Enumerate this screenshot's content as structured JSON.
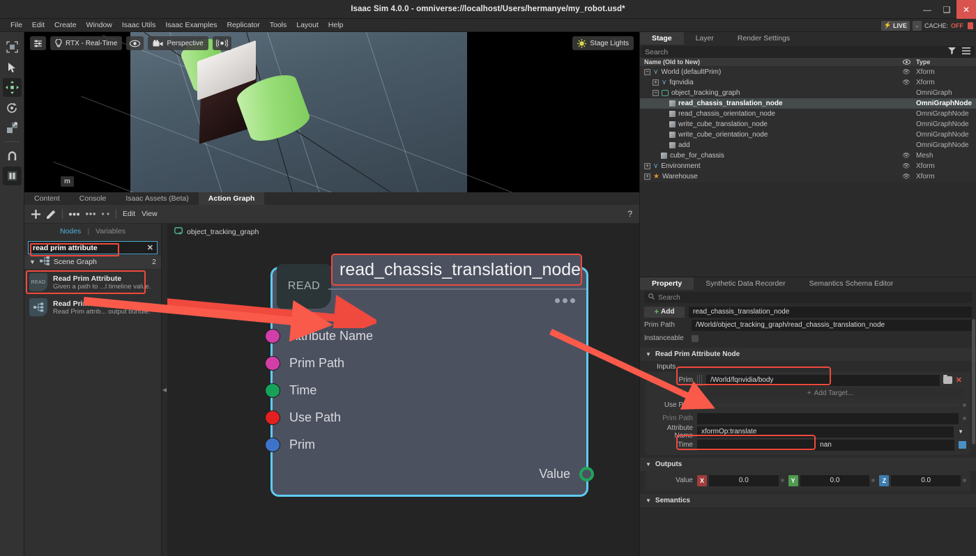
{
  "window": {
    "title": "Isaac Sim 4.0.0 - omniverse://localhost/Users/hermanye/my_robot.usd*",
    "minimize": "—",
    "maximize": "❑",
    "close": "✕"
  },
  "menubar": {
    "items": [
      "File",
      "Edit",
      "Create",
      "Window",
      "Isaac Utils",
      "Isaac Examples",
      "Replicator",
      "Tools",
      "Layout",
      "Help"
    ],
    "live_label": "LIVE",
    "live_caret": "⌄",
    "cache_label": "CACHE:",
    "cache_value": "OFF"
  },
  "left_toolbar": {
    "items": [
      {
        "name": "select-bounds-tool",
        "glyph": "⬛"
      },
      {
        "name": "cursor-tool",
        "glyph": "➤"
      },
      {
        "name": "move-tool",
        "glyph": "✣"
      },
      {
        "name": "rotate-tool",
        "glyph": "⟳"
      },
      {
        "name": "scale-tool",
        "glyph": "⤡"
      },
      {
        "name": "snap-tool",
        "glyph": "∩"
      },
      {
        "name": "pause-tool",
        "glyph": "❙❙"
      }
    ]
  },
  "viewport": {
    "render_mode": "RTX - Real-Time",
    "camera": "Perspective",
    "lighting": "Stage Lights",
    "unit": "m",
    "settings_icon": "sliders-icon",
    "eye_icon": "eye-icon",
    "audio_icon": "audio-icon"
  },
  "dock_tabs": {
    "items": [
      "Content",
      "Console",
      "Isaac Assets (Beta)",
      "Action Graph"
    ],
    "active": "Action Graph"
  },
  "graph_toolbar": {
    "add": "+",
    "edit_pencil": "✎",
    "menu_edit": "Edit",
    "menu_view": "View",
    "help": "?"
  },
  "node_browser": {
    "tabs": [
      "Nodes",
      "Variables"
    ],
    "active_tab": "Nodes",
    "search_value": "read prim attribute",
    "clear_icon": "✕",
    "group": {
      "label": "Scene Graph",
      "count": "2"
    },
    "results": [
      {
        "icon_text": "READ",
        "title": "Read Prim Attribute",
        "desc": "Given a path to ...l timeline value.",
        "highlighted": true
      },
      {
        "icon_text": "",
        "title": "Read Prim Attributes",
        "desc": "Read Prim attrib... output bundle.",
        "highlighted": false
      }
    ]
  },
  "graph_canvas": {
    "breadcrumb": "object_tracking_graph",
    "node": {
      "badge": "READ",
      "title": "read_chassis_translation_node",
      "inputs": [
        {
          "label": "Attribute Name",
          "color": "#d23ea8"
        },
        {
          "label": "Prim Path",
          "color": "#d23ea8"
        },
        {
          "label": "Time",
          "color": "#17a25a"
        },
        {
          "label": "Use Path",
          "color": "#e32020"
        },
        {
          "label": "Prim",
          "color": "#3d74c9"
        }
      ],
      "outputs": [
        {
          "label": "Value",
          "color": "#20a55c"
        }
      ]
    }
  },
  "stage_panel": {
    "tabs": [
      "Stage",
      "Layer",
      "Render Settings"
    ],
    "active_tab": "Stage",
    "search_placeholder": "Search",
    "filter_icon": "filter-icon",
    "menu_icon": "hamburger-icon",
    "columns": {
      "name": "Name (Old to New)",
      "eye": "eye-icon",
      "type": "Type"
    },
    "rows": [
      {
        "name": "World (defaultPrim)",
        "type": "Xform",
        "indent": 0,
        "expander": "−",
        "icon": "axis",
        "eye": true,
        "selected": false
      },
      {
        "name": "fqnvidia",
        "type": "Xform",
        "indent": 1,
        "expander": "+",
        "icon": "axis",
        "eye": true,
        "selected": false
      },
      {
        "name": "object_tracking_graph",
        "type": "OmniGraph",
        "indent": 1,
        "expander": "−",
        "icon": "graph",
        "eye": false,
        "selected": false
      },
      {
        "name": "read_chassis_translation_node",
        "type": "OmniGraphNode",
        "indent": 3,
        "expander": "",
        "icon": "cube",
        "eye": false,
        "selected": true
      },
      {
        "name": "read_chassis_orientation_node",
        "type": "OmniGraphNode",
        "indent": 3,
        "expander": "",
        "icon": "cube",
        "eye": false,
        "selected": false
      },
      {
        "name": "write_cube_translation_node",
        "type": "OmniGraphNode",
        "indent": 3,
        "expander": "",
        "icon": "cube",
        "eye": false,
        "selected": false
      },
      {
        "name": "write_cube_orientation_node",
        "type": "OmniGraphNode",
        "indent": 3,
        "expander": "",
        "icon": "cube",
        "eye": false,
        "selected": false
      },
      {
        "name": "add",
        "type": "OmniGraphNode",
        "indent": 3,
        "expander": "",
        "icon": "cube",
        "eye": false,
        "selected": false
      },
      {
        "name": "cube_for_chassis",
        "type": "Mesh",
        "indent": 2,
        "expander": "",
        "icon": "cube",
        "eye": true,
        "selected": false
      },
      {
        "name": "Environment",
        "type": "Xform",
        "indent": 0,
        "expander": "+",
        "icon": "axis",
        "eye": true,
        "selected": false
      },
      {
        "name": "Warehouse",
        "type": "Xform",
        "indent": 0,
        "expander": "+",
        "icon": "warehouse",
        "eye": true,
        "selected": false
      }
    ]
  },
  "property_panel": {
    "tabs": [
      "Property",
      "Synthetic Data Recorder",
      "Semantics Schema Editor"
    ],
    "active_tab": "Property",
    "search_placeholder": "Search",
    "add_button": "Add",
    "name_value": "read_chassis_translation_node",
    "prim_path_label": "Prim Path",
    "prim_path_value": "/World/object_tracking_graph/read_chassis_translation_node",
    "instanceable_label": "Instanceable",
    "section_node": "Read Prim Attribute Node",
    "section_inputs": "Inputs",
    "section_outputs": "Outputs",
    "section_semantics": "Semantics",
    "fields": {
      "prim_label": "Prim",
      "prim_value": "/World/fqnvidia/body",
      "add_target": "Add Target...",
      "use_path_label": "Use Path",
      "prim_path_field_label": "Prim Path",
      "prim_path_field_value": "",
      "attribute_name_label": "Attribute Name",
      "attribute_name_value": "xformOp:translate",
      "time_label": "Time",
      "time_value": "nan"
    },
    "outputs": {
      "value_label": "Value",
      "channels": [
        {
          "axis": "X",
          "value": "0.0"
        },
        {
          "axis": "Y",
          "value": "0.0"
        },
        {
          "axis": "Z",
          "value": "0.0"
        }
      ]
    }
  }
}
